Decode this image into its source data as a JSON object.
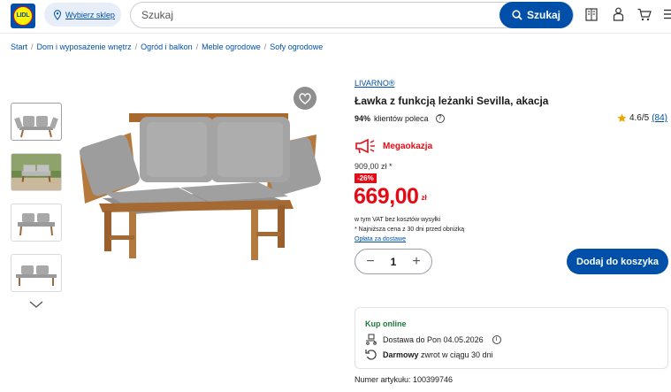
{
  "header": {
    "logo_text": "LIDL",
    "store_button_label": "Wybierz sklep",
    "search_placeholder": "Szukaj",
    "search_button_label": "Szukaj",
    "icons": [
      "leaflet-icon",
      "account-icon",
      "cart-icon",
      "menu-icon"
    ],
    "brand_color": "#0050aa"
  },
  "breadcrumb": [
    "Start",
    "Dom i wyposażenie wnętrz",
    "Ogród i balkon",
    "Meble ogrodowe",
    "Sofy ogrodowe"
  ],
  "gallery": {
    "thumbnails": [
      "bench-front",
      "bench-scene",
      "bench-flat",
      "bench-side"
    ]
  },
  "product": {
    "brand": "LIVARNO®",
    "title": "Ławka z funkcją leżanki Sevilla, akacja",
    "recommend_pct": "94%",
    "recommend_text": "klientów poleca",
    "rating": "4.6/5",
    "rating_count": "(84)",
    "promo_label": "Megaokazja",
    "old_price": "909,00 zł *",
    "discount": "-26%",
    "price": "669,00",
    "price_currency": "zł",
    "vat_note": "w tym VAT bez kosztów wysyłki",
    "lowest_note": "* Najniższa cena z 30 dni przed obniżką",
    "delivery_fee_link": "Opłata za dostawę",
    "quantity": "1",
    "add_to_cart_label": "Dodaj do koszyka",
    "sale_color": "#e60a14"
  },
  "online": {
    "heading": "Kup online",
    "delivery_text": "Dostawa do Pon 04.05.2026",
    "return_bold": "Darmowy",
    "return_text": "zwrot w ciągu 30 dni"
  },
  "article_number": "Numer artykułu: 100399746"
}
